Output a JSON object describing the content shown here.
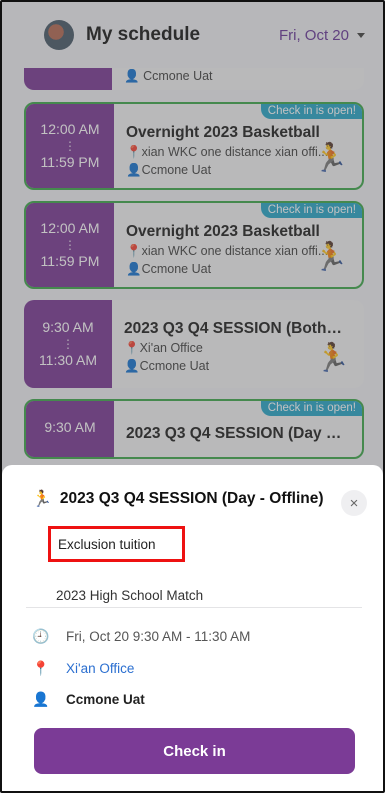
{
  "header": {
    "title": "My schedule",
    "date": "Fri, Oct 20"
  },
  "list": {
    "partial_event": {
      "organizer": "Ccmone Uat"
    },
    "events": [
      {
        "start": "12:00 AM",
        "dots": "⋮",
        "end": "11:59 PM",
        "title": "Overnight 2023 Basketball",
        "location": "xian WKC one distance xian offi...",
        "organizer": "Ccmone Uat",
        "badge": "Check in is open!"
      },
      {
        "start": "12:00 AM",
        "dots": "⋮",
        "end": "11:59 PM",
        "title": "Overnight 2023 Basketball",
        "location": "xian WKC one distance xian offi...",
        "organizer": "Ccmone Uat",
        "badge": "Check in is open!"
      },
      {
        "start": "9:30 AM",
        "dots": "⋮",
        "end": "11:30 AM",
        "title": "2023 Q3 Q4 SESSION (Both -...",
        "location": "Xi'an Office",
        "organizer": "Ccmone Uat",
        "badge": ""
      },
      {
        "start": "9:30 AM",
        "dots": "",
        "end": "",
        "title": "2023 Q3 Q4 SESSION (Day - O...",
        "location": "",
        "organizer": "",
        "badge": "Check in is open!"
      }
    ]
  },
  "sheet": {
    "title": "2023 Q3 Q4 SESSION (Day - Offline)",
    "tag": "Exclusion tuition",
    "subtitle": "2023 High School Match",
    "time": "Fri, Oct 20 9:30 AM - 11:30 AM",
    "location": "Xi'an Office",
    "organizer": "Ccmone Uat",
    "checkin_label": "Check in",
    "close_glyph": "×"
  },
  "colors": {
    "brand": "#7b3b96",
    "open_border": "#3fa84d",
    "badge": "#2aa6c8",
    "link": "#2b6fd0",
    "highlight": "#e11111"
  }
}
